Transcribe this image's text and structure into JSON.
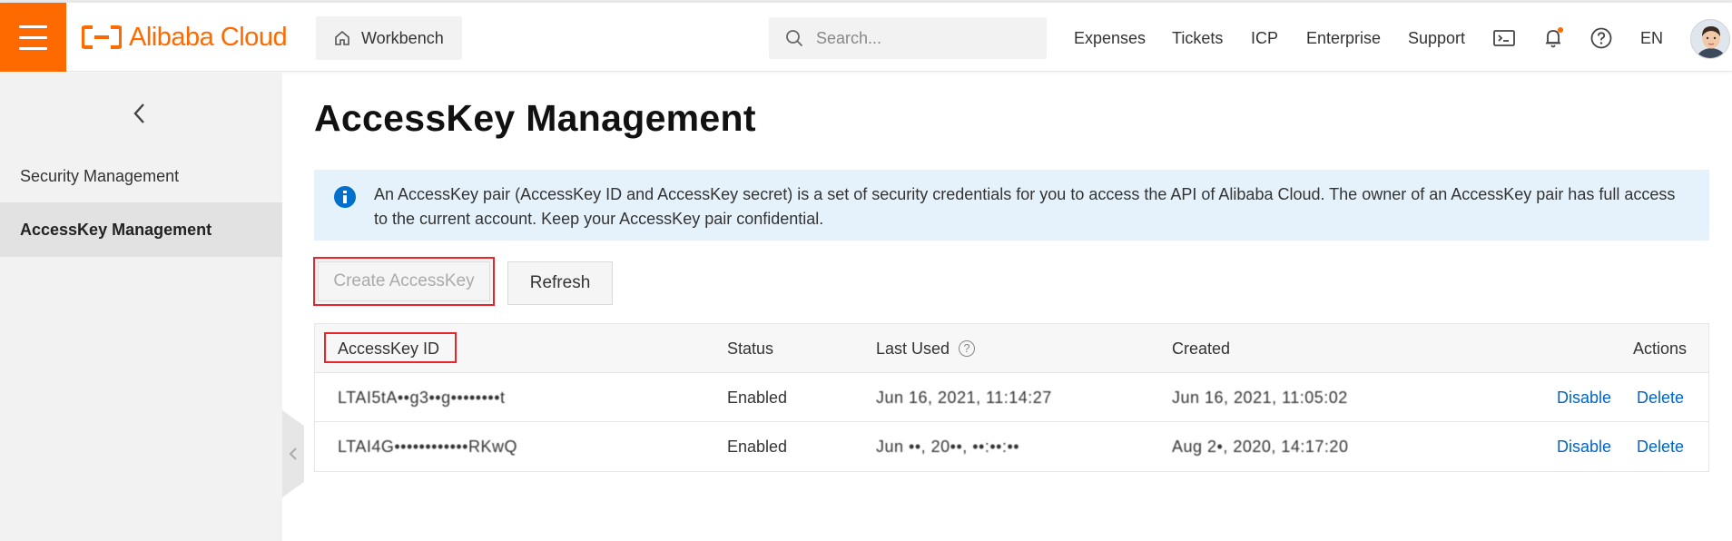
{
  "header": {
    "brand": "Alibaba Cloud",
    "workbench_label": "Workbench",
    "search_placeholder": "Search...",
    "nav_links": [
      "Expenses",
      "Tickets",
      "ICP",
      "Enterprise",
      "Support"
    ],
    "language": "EN",
    "colors": {
      "brand": "#ff6a00",
      "notification_dot": "#ff6a00"
    },
    "icons": [
      "menu-icon",
      "home-icon",
      "search-icon",
      "terminal-icon",
      "bell-icon",
      "help-circle-icon",
      "avatar"
    ]
  },
  "sidebar": {
    "items": [
      {
        "label": "Security Management",
        "active": false
      },
      {
        "label": "AccessKey Management",
        "active": true
      }
    ]
  },
  "main": {
    "title": "AccessKey Management",
    "notice": "An AccessKey pair (AccessKey ID and AccessKey secret) is a set of security credentials for you to access the API of Alibaba Cloud. The owner of an AccessKey pair has full access to the current account. Keep your AccessKey pair confidential.",
    "buttons": {
      "create": "Create AccessKey",
      "refresh": "Refresh"
    },
    "table": {
      "columns": [
        "AccessKey ID",
        "Status",
        "Last Used",
        "Created",
        "Actions"
      ],
      "rows": [
        {
          "id": "LTAI5tA••g3••g••••••••t",
          "status": "Enabled",
          "last_used": "Jun 16, 2021, 11:14:27",
          "created": "Jun 16, 2021, 11:05:02",
          "action_disable": "Disable",
          "action_delete": "Delete"
        },
        {
          "id": "LTAI4G••••••••••••RKwQ",
          "status": "Enabled",
          "last_used": "Jun ••, 20••, ••:••:••",
          "created": "Aug 2•, 2020, 14:17:20",
          "action_disable": "Disable",
          "action_delete": "Delete"
        }
      ]
    }
  }
}
